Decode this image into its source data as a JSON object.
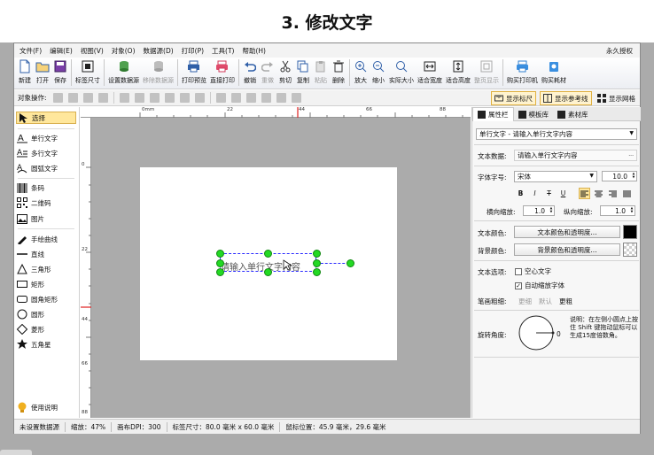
{
  "heading": "3. 修改文字",
  "menubar": {
    "items": [
      "文件(F)",
      "编辑(E)",
      "视图(V)",
      "对象(O)",
      "数据源(D)",
      "打印(P)",
      "工具(T)",
      "帮助(H)"
    ],
    "right": "永久授权"
  },
  "toolbar": [
    {
      "label": "新建",
      "icon": "new-file-icon"
    },
    {
      "label": "打开",
      "icon": "open-folder-icon"
    },
    {
      "label": "保存",
      "icon": "save-icon"
    },
    {
      "label": "标签尺寸",
      "icon": "label-size-icon"
    },
    {
      "label": "设置数据源",
      "icon": "database-icon"
    },
    {
      "label": "移除数据源",
      "icon": "remove-database-icon"
    },
    {
      "label": "打印预览",
      "icon": "print-preview-icon"
    },
    {
      "label": "直接打印",
      "icon": "printer-icon"
    },
    {
      "label": "撤销",
      "icon": "undo-icon"
    },
    {
      "label": "重做",
      "icon": "redo-icon"
    },
    {
      "label": "剪切",
      "icon": "cut-icon"
    },
    {
      "label": "复制",
      "icon": "copy-icon"
    },
    {
      "label": "粘贴",
      "icon": "paste-icon"
    },
    {
      "label": "删除",
      "icon": "delete-icon"
    },
    {
      "label": "放大",
      "icon": "zoom-in-icon"
    },
    {
      "label": "缩小",
      "icon": "zoom-out-icon"
    },
    {
      "label": "实际大小",
      "icon": "actual-size-icon"
    },
    {
      "label": "适合宽度",
      "icon": "fit-width-icon"
    },
    {
      "label": "适合高度",
      "icon": "fit-height-icon"
    },
    {
      "label": "整页显示",
      "icon": "full-page-icon"
    },
    {
      "label": "购买打印机",
      "icon": "buy-printer-icon"
    },
    {
      "label": "购买耗材",
      "icon": "buy-supplies-icon"
    }
  ],
  "objbar": {
    "label": "对象操作:",
    "show_ruler": "显示标尺",
    "show_guides": "显示参考线",
    "show_grid": "显示网格"
  },
  "tools": [
    {
      "label": "选择",
      "icon": "cursor-arrow-icon"
    },
    {
      "label": "单行文字",
      "icon": "single-line-text-icon"
    },
    {
      "label": "多行文字",
      "icon": "multi-line-text-icon"
    },
    {
      "label": "圆弧文字",
      "icon": "arc-text-icon"
    },
    {
      "label": "条码",
      "icon": "barcode-icon"
    },
    {
      "label": "二维码",
      "icon": "qrcode-icon"
    },
    {
      "label": "图片",
      "icon": "image-icon"
    },
    {
      "label": "手绘曲线",
      "icon": "freehand-icon"
    },
    {
      "label": "直线",
      "icon": "line-icon"
    },
    {
      "label": "三角形",
      "icon": "triangle-icon"
    },
    {
      "label": "矩形",
      "icon": "rectangle-icon"
    },
    {
      "label": "圆角矩形",
      "icon": "rounded-rect-icon"
    },
    {
      "label": "圆形",
      "icon": "circle-icon"
    },
    {
      "label": "菱形",
      "icon": "diamond-icon"
    },
    {
      "label": "五角星",
      "icon": "star-icon"
    },
    {
      "label": "使用说明",
      "icon": "lightbulb-icon"
    }
  ],
  "ruler": {
    "h_ticks": [
      "0mm",
      "22",
      "44",
      "66",
      "88"
    ],
    "v_ticks": [
      "0",
      "22",
      "44",
      "66",
      "88"
    ]
  },
  "canvas": {
    "text": "请输入单行文字内容"
  },
  "props": {
    "tabs": [
      "属性栏",
      "模板库",
      "素材库"
    ],
    "object_select": "单行文字 - 请输入单行文字内容",
    "text_data_label": "文本数据:",
    "text_data_value": "请输入单行文字内容",
    "text_data_more": "...",
    "font_label": "字体字号:",
    "font_value": "宋体",
    "font_size": "10.0",
    "format_buttons": [
      "B",
      "I",
      "T",
      "U"
    ],
    "h_scale_label": "横向缩放:",
    "h_scale_value": "1.0",
    "v_scale_label": "纵向缩放:",
    "v_scale_value": "1.0",
    "text_color_label": "文本颜色:",
    "text_color_button": "文本颜色和透明度...",
    "text_color": "#000000",
    "bg_color_label": "背景颜色:",
    "bg_color_button": "背景颜色和透明度...",
    "text_options_label": "文本选项:",
    "hollow_text": "空心文字",
    "auto_scale_font": "自动缩放字体",
    "stroke_label": "笔画粗细:",
    "stroke_options": [
      "更细",
      "默认",
      "更粗"
    ],
    "rotation_label": "旋转角度:",
    "rotation_value": "0",
    "rotation_note": "说明：在左侧小圆点上按住 Shift 键拖动鼠标可以生成15度倍数角。"
  },
  "status": {
    "datasource": "未设置数据源",
    "zoom": "缩放：47%",
    "dpi": "画布DPI：300",
    "label_size": "标签尺寸：80.0 毫米 x 60.0 毫米",
    "mouse_pos": "鼠标位置：45.9 毫米，29.6 毫米"
  },
  "colors": {
    "accent": "#ffe79c",
    "handle": "#23d923",
    "selection": "#2a2aff"
  }
}
